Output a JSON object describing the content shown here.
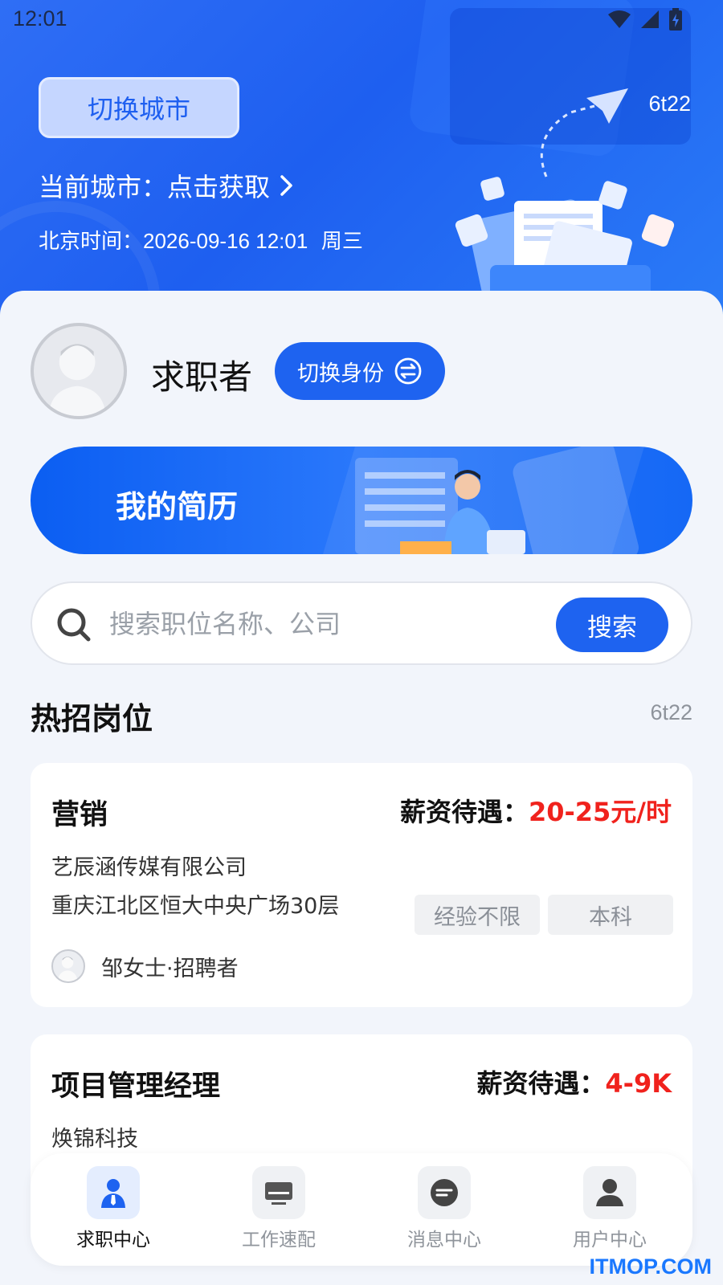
{
  "status_bar": {
    "time": "12:01"
  },
  "header": {
    "switch_city_label": "切换城市",
    "current_city": "当前城市：点击获取",
    "beijing_time_label": "北京时间：",
    "beijing_time_value": "2026-09-16 12:01",
    "weekday": "周三",
    "top_right_code": "6t22"
  },
  "profile": {
    "role": "求职者",
    "switch_role_label": "切换身份"
  },
  "resume_banner": {
    "label": "我的简历"
  },
  "search": {
    "placeholder": "搜索职位名称、公司",
    "value": "",
    "button_label": "搜索"
  },
  "hot_jobs": {
    "title": "热招岗位",
    "code": "6t22",
    "salary_label": "薪资待遇：",
    "jobs": [
      {
        "title": "营销",
        "salary": "20-25元/时",
        "company": "艺辰涵传媒有限公司",
        "address": "重庆江北区恒大中央广场30层",
        "tags": [
          "经验不限",
          "本科"
        ],
        "recruiter": "邹女士·招聘者"
      },
      {
        "title": "项目管理经理",
        "salary": "4-9K",
        "company": "焕锦科技"
      }
    ]
  },
  "tabbar": {
    "items": [
      {
        "label": "求职中心",
        "icon": "job-seeker-icon",
        "active": true
      },
      {
        "label": "工作速配",
        "icon": "monitor-icon",
        "active": false
      },
      {
        "label": "消息中心",
        "icon": "message-icon",
        "active": false
      },
      {
        "label": "用户中心",
        "icon": "user-icon",
        "active": false
      }
    ]
  },
  "watermark": "ITMOP.COM",
  "colors": {
    "primary": "#1e63f0",
    "salary": "#f0221d",
    "background": "#f2f5fb"
  }
}
